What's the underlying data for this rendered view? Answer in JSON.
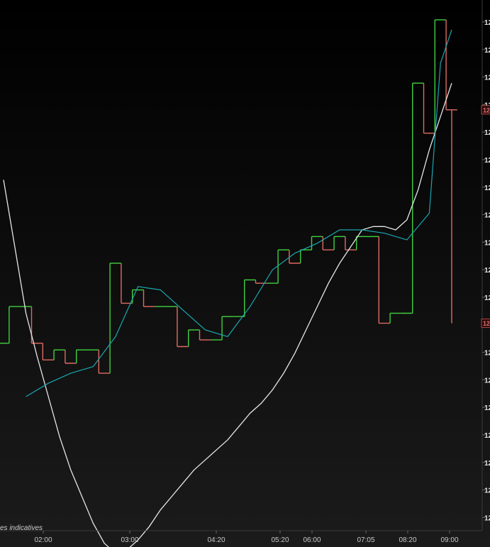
{
  "chart_data": {
    "type": "line",
    "style": "step (up=green, down=red) with two moving averages",
    "footnote": "es indicatives",
    "x_axis": {
      "tick_labels": [
        "02:00",
        "03:00",
        "04:20",
        "05:20",
        "06:00",
        "07:05",
        "08:20",
        "09:00"
      ]
    },
    "y_axis": {
      "side": "right",
      "tick_labels": [
        "12",
        "12",
        "12",
        "12",
        "12",
        "12",
        "12",
        "12",
        "12",
        "12",
        "12",
        "12",
        "12",
        "12",
        "12",
        "12",
        "12",
        "12",
        "12"
      ],
      "price_tags": [
        "12",
        "12"
      ]
    },
    "colors": {
      "up": "#3fd13f",
      "down": "#e06a62",
      "ma_fast": "#1aa6b0",
      "ma_slow": "#e6e6e6",
      "background_top": "#000000",
      "background_bottom": "#1b1b1b"
    },
    "series": [
      {
        "role": "price",
        "x": [
          0,
          1,
          2,
          3,
          4,
          5,
          6,
          7,
          8,
          9,
          10,
          11,
          12,
          13,
          14,
          15,
          16,
          17,
          18,
          19,
          20,
          21,
          22,
          23,
          24,
          25,
          26,
          27,
          28,
          29,
          30,
          31,
          32,
          33,
          34,
          35,
          36,
          37,
          38,
          39,
          40
        ],
        "values": [
          46,
          57,
          57,
          46,
          41,
          44,
          40,
          44,
          44,
          37,
          70,
          58,
          62,
          57,
          57,
          57,
          45,
          50,
          47,
          47,
          54,
          54,
          65,
          64,
          64,
          74,
          70,
          74,
          78,
          74,
          78,
          74,
          78,
          78,
          52,
          55,
          55,
          124,
          109,
          143,
          116
        ]
      },
      {
        "role": "ma_fast",
        "x": [
          2,
          4,
          6,
          8,
          10,
          12,
          14,
          16,
          18,
          20,
          22,
          24,
          26,
          28,
          30,
          32,
          34,
          36,
          38,
          39,
          40
        ],
        "values": [
          30,
          34,
          37,
          39,
          48,
          63,
          62,
          56,
          50,
          48,
          57,
          68,
          73,
          76,
          80,
          80,
          79,
          77,
          85,
          130,
          140
        ]
      },
      {
        "role": "ma_slow",
        "x": [
          0,
          1,
          2,
          3,
          4,
          5,
          6,
          7,
          8,
          9,
          10,
          11,
          12,
          13,
          14,
          15,
          16,
          17,
          18,
          19,
          20,
          21,
          22,
          23,
          24,
          25,
          26,
          27,
          28,
          29,
          30,
          31,
          32,
          33,
          34,
          35,
          36,
          37,
          38,
          39,
          40
        ],
        "values": [
          95,
          75,
          55,
          42,
          30,
          18,
          8,
          0,
          -8,
          -14,
          -17,
          -16,
          -13,
          -9,
          -4,
          0,
          4,
          8,
          11,
          14,
          17,
          21,
          25,
          28,
          32,
          37,
          43,
          50,
          57,
          64,
          70,
          75,
          80,
          81,
          81,
          80,
          83,
          92,
          104,
          114,
          124
        ]
      }
    ],
    "last_value_markers": [
      {
        "series": "price",
        "value": 116
      },
      {
        "series": "price_low",
        "value": 52
      }
    ]
  }
}
